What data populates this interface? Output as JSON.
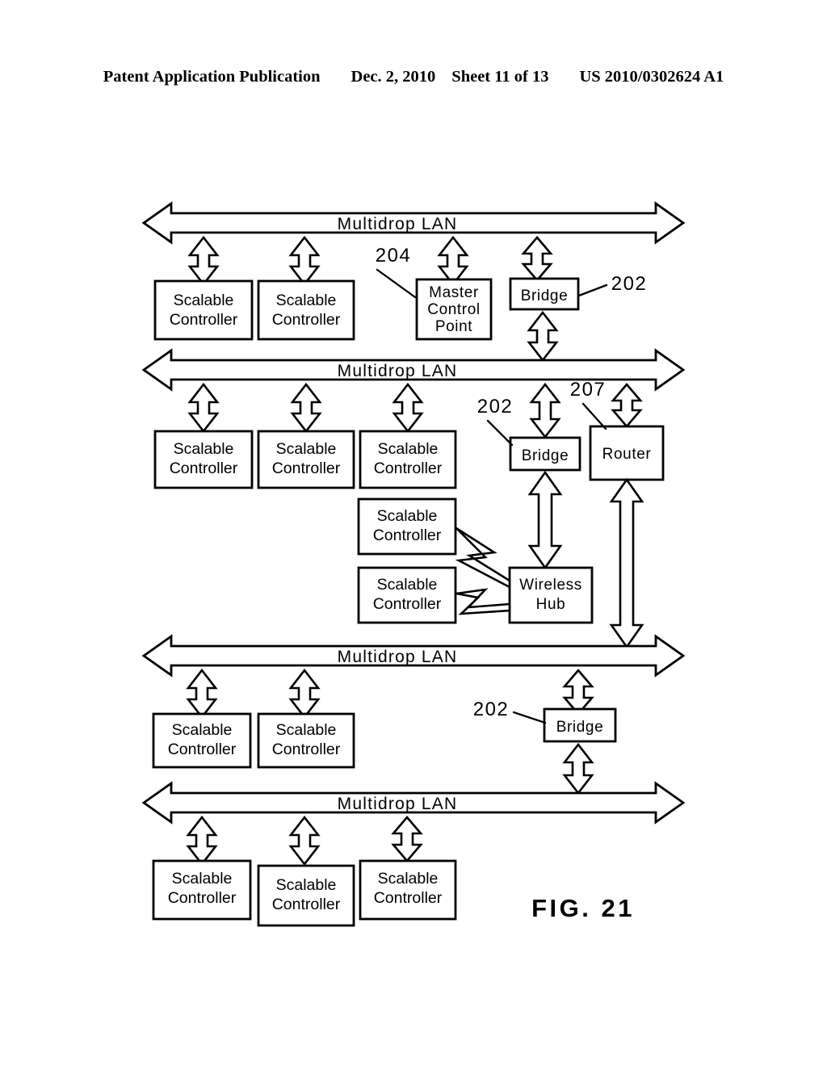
{
  "header": {
    "publication": "Patent Application Publication",
    "date": "Dec. 2, 2010",
    "sheet": "Sheet 11 of 13",
    "patent_number": "US 2010/0302624 A1"
  },
  "figure": {
    "label": "FIG. 21",
    "buses": [
      {
        "id": "lan1",
        "label": "Multidrop  LAN"
      },
      {
        "id": "lan2",
        "label": "Multidrop  LAN"
      },
      {
        "id": "lan3",
        "label": "Multidrop  LAN"
      },
      {
        "id": "lan4",
        "label": "Multidrop  LAN"
      }
    ],
    "nodes": [
      {
        "id": "sc-1-1",
        "line1": "Scalable",
        "line2": "Controller"
      },
      {
        "id": "sc-1-2",
        "line1": "Scalable",
        "line2": "Controller"
      },
      {
        "id": "mcp",
        "line1": "Master",
        "line2": "Control",
        "line3": "Point"
      },
      {
        "id": "bridge-1",
        "line1": "Bridge"
      },
      {
        "id": "sc-2-1",
        "line1": "Scalable",
        "line2": "Controller"
      },
      {
        "id": "sc-2-2",
        "line1": "Scalable",
        "line2": "Controller"
      },
      {
        "id": "sc-2-3",
        "line1": "Scalable",
        "line2": "Controller"
      },
      {
        "id": "bridge-2",
        "line1": "Bridge"
      },
      {
        "id": "router",
        "line1": "Router"
      },
      {
        "id": "sc-w-1",
        "line1": "Scalable",
        "line2": "Controller"
      },
      {
        "id": "sc-w-2",
        "line1": "Scalable",
        "line2": "Controller"
      },
      {
        "id": "wireless-hub",
        "line1": "Wireless",
        "line2": "Hub"
      },
      {
        "id": "sc-3-1",
        "line1": "Scalable",
        "line2": "Controller"
      },
      {
        "id": "sc-3-2",
        "line1": "Scalable",
        "line2": "Controller"
      },
      {
        "id": "bridge-3",
        "line1": "Bridge"
      },
      {
        "id": "sc-4-1",
        "line1": "Scalable",
        "line2": "Controller"
      },
      {
        "id": "sc-4-2",
        "line1": "Scalable",
        "line2": "Controller"
      },
      {
        "id": "sc-4-3",
        "line1": "Scalable",
        "line2": "Controller"
      }
    ],
    "reference_numerals": [
      {
        "id": "ref-204",
        "value": "204",
        "points_to": "mcp"
      },
      {
        "id": "ref-202-a",
        "value": "202",
        "points_to": "bridge-1"
      },
      {
        "id": "ref-202-b",
        "value": "202",
        "points_to": "bridge-2"
      },
      {
        "id": "ref-207",
        "value": "207",
        "points_to": "router"
      },
      {
        "id": "ref-202-c",
        "value": "202",
        "points_to": "bridge-3"
      }
    ]
  }
}
